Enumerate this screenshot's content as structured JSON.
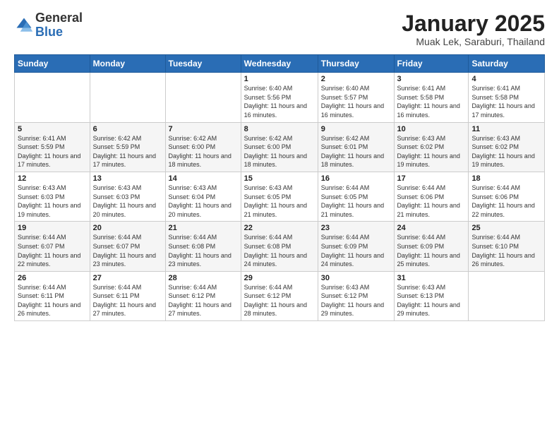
{
  "logo": {
    "general": "General",
    "blue": "Blue"
  },
  "title": "January 2025",
  "location": "Muak Lek, Saraburi, Thailand",
  "headers": [
    "Sunday",
    "Monday",
    "Tuesday",
    "Wednesday",
    "Thursday",
    "Friday",
    "Saturday"
  ],
  "weeks": [
    [
      {
        "day": "",
        "sunrise": "",
        "sunset": "",
        "daylight": ""
      },
      {
        "day": "",
        "sunrise": "",
        "sunset": "",
        "daylight": ""
      },
      {
        "day": "",
        "sunrise": "",
        "sunset": "",
        "daylight": ""
      },
      {
        "day": "1",
        "sunrise": "Sunrise: 6:40 AM",
        "sunset": "Sunset: 5:56 PM",
        "daylight": "Daylight: 11 hours and 16 minutes."
      },
      {
        "day": "2",
        "sunrise": "Sunrise: 6:40 AM",
        "sunset": "Sunset: 5:57 PM",
        "daylight": "Daylight: 11 hours and 16 minutes."
      },
      {
        "day": "3",
        "sunrise": "Sunrise: 6:41 AM",
        "sunset": "Sunset: 5:58 PM",
        "daylight": "Daylight: 11 hours and 16 minutes."
      },
      {
        "day": "4",
        "sunrise": "Sunrise: 6:41 AM",
        "sunset": "Sunset: 5:58 PM",
        "daylight": "Daylight: 11 hours and 17 minutes."
      }
    ],
    [
      {
        "day": "5",
        "sunrise": "Sunrise: 6:41 AM",
        "sunset": "Sunset: 5:59 PM",
        "daylight": "Daylight: 11 hours and 17 minutes."
      },
      {
        "day": "6",
        "sunrise": "Sunrise: 6:42 AM",
        "sunset": "Sunset: 5:59 PM",
        "daylight": "Daylight: 11 hours and 17 minutes."
      },
      {
        "day": "7",
        "sunrise": "Sunrise: 6:42 AM",
        "sunset": "Sunset: 6:00 PM",
        "daylight": "Daylight: 11 hours and 18 minutes."
      },
      {
        "day": "8",
        "sunrise": "Sunrise: 6:42 AM",
        "sunset": "Sunset: 6:00 PM",
        "daylight": "Daylight: 11 hours and 18 minutes."
      },
      {
        "day": "9",
        "sunrise": "Sunrise: 6:42 AM",
        "sunset": "Sunset: 6:01 PM",
        "daylight": "Daylight: 11 hours and 18 minutes."
      },
      {
        "day": "10",
        "sunrise": "Sunrise: 6:43 AM",
        "sunset": "Sunset: 6:02 PM",
        "daylight": "Daylight: 11 hours and 19 minutes."
      },
      {
        "day": "11",
        "sunrise": "Sunrise: 6:43 AM",
        "sunset": "Sunset: 6:02 PM",
        "daylight": "Daylight: 11 hours and 19 minutes."
      }
    ],
    [
      {
        "day": "12",
        "sunrise": "Sunrise: 6:43 AM",
        "sunset": "Sunset: 6:03 PM",
        "daylight": "Daylight: 11 hours and 19 minutes."
      },
      {
        "day": "13",
        "sunrise": "Sunrise: 6:43 AM",
        "sunset": "Sunset: 6:03 PM",
        "daylight": "Daylight: 11 hours and 20 minutes."
      },
      {
        "day": "14",
        "sunrise": "Sunrise: 6:43 AM",
        "sunset": "Sunset: 6:04 PM",
        "daylight": "Daylight: 11 hours and 20 minutes."
      },
      {
        "day": "15",
        "sunrise": "Sunrise: 6:43 AM",
        "sunset": "Sunset: 6:05 PM",
        "daylight": "Daylight: 11 hours and 21 minutes."
      },
      {
        "day": "16",
        "sunrise": "Sunrise: 6:44 AM",
        "sunset": "Sunset: 6:05 PM",
        "daylight": "Daylight: 11 hours and 21 minutes."
      },
      {
        "day": "17",
        "sunrise": "Sunrise: 6:44 AM",
        "sunset": "Sunset: 6:06 PM",
        "daylight": "Daylight: 11 hours and 21 minutes."
      },
      {
        "day": "18",
        "sunrise": "Sunrise: 6:44 AM",
        "sunset": "Sunset: 6:06 PM",
        "daylight": "Daylight: 11 hours and 22 minutes."
      }
    ],
    [
      {
        "day": "19",
        "sunrise": "Sunrise: 6:44 AM",
        "sunset": "Sunset: 6:07 PM",
        "daylight": "Daylight: 11 hours and 22 minutes."
      },
      {
        "day": "20",
        "sunrise": "Sunrise: 6:44 AM",
        "sunset": "Sunset: 6:07 PM",
        "daylight": "Daylight: 11 hours and 23 minutes."
      },
      {
        "day": "21",
        "sunrise": "Sunrise: 6:44 AM",
        "sunset": "Sunset: 6:08 PM",
        "daylight": "Daylight: 11 hours and 23 minutes."
      },
      {
        "day": "22",
        "sunrise": "Sunrise: 6:44 AM",
        "sunset": "Sunset: 6:08 PM",
        "daylight": "Daylight: 11 hours and 24 minutes."
      },
      {
        "day": "23",
        "sunrise": "Sunrise: 6:44 AM",
        "sunset": "Sunset: 6:09 PM",
        "daylight": "Daylight: 11 hours and 24 minutes."
      },
      {
        "day": "24",
        "sunrise": "Sunrise: 6:44 AM",
        "sunset": "Sunset: 6:09 PM",
        "daylight": "Daylight: 11 hours and 25 minutes."
      },
      {
        "day": "25",
        "sunrise": "Sunrise: 6:44 AM",
        "sunset": "Sunset: 6:10 PM",
        "daylight": "Daylight: 11 hours and 26 minutes."
      }
    ],
    [
      {
        "day": "26",
        "sunrise": "Sunrise: 6:44 AM",
        "sunset": "Sunset: 6:11 PM",
        "daylight": "Daylight: 11 hours and 26 minutes."
      },
      {
        "day": "27",
        "sunrise": "Sunrise: 6:44 AM",
        "sunset": "Sunset: 6:11 PM",
        "daylight": "Daylight: 11 hours and 27 minutes."
      },
      {
        "day": "28",
        "sunrise": "Sunrise: 6:44 AM",
        "sunset": "Sunset: 6:12 PM",
        "daylight": "Daylight: 11 hours and 27 minutes."
      },
      {
        "day": "29",
        "sunrise": "Sunrise: 6:44 AM",
        "sunset": "Sunset: 6:12 PM",
        "daylight": "Daylight: 11 hours and 28 minutes."
      },
      {
        "day": "30",
        "sunrise": "Sunrise: 6:43 AM",
        "sunset": "Sunset: 6:12 PM",
        "daylight": "Daylight: 11 hours and 29 minutes."
      },
      {
        "day": "31",
        "sunrise": "Sunrise: 6:43 AM",
        "sunset": "Sunset: 6:13 PM",
        "daylight": "Daylight: 11 hours and 29 minutes."
      },
      {
        "day": "",
        "sunrise": "",
        "sunset": "",
        "daylight": ""
      }
    ]
  ]
}
